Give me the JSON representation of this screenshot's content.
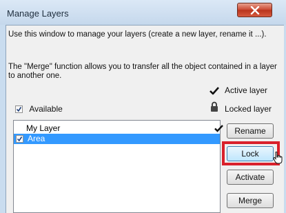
{
  "window": {
    "title": "Manage Layers",
    "close_icon": "close-x-icon"
  },
  "description": {
    "line1": "Use this window to manage your layers (create a new layer, rename it ...).",
    "line2": "The \"Merge\" function allows you to transfer all the object contained in a layer to another one."
  },
  "legend": {
    "active_label": "Active layer",
    "active_icon": "checkmark-icon",
    "locked_label": "Locked layer",
    "locked_icon": "padlock-icon"
  },
  "filter": {
    "available_label": "Available",
    "available_checked": true
  },
  "layers": [
    {
      "name": "My Layer",
      "active": true,
      "checked": false,
      "selected": false
    },
    {
      "name": "Area",
      "active": false,
      "checked": true,
      "selected": true
    }
  ],
  "buttons": {
    "rename": "Rename",
    "lock": "Lock",
    "activate": "Activate",
    "merge": "Merge"
  },
  "colors": {
    "selection": "#3399ff",
    "highlight": "#d9202b",
    "titlebar": "#c9dcef"
  }
}
